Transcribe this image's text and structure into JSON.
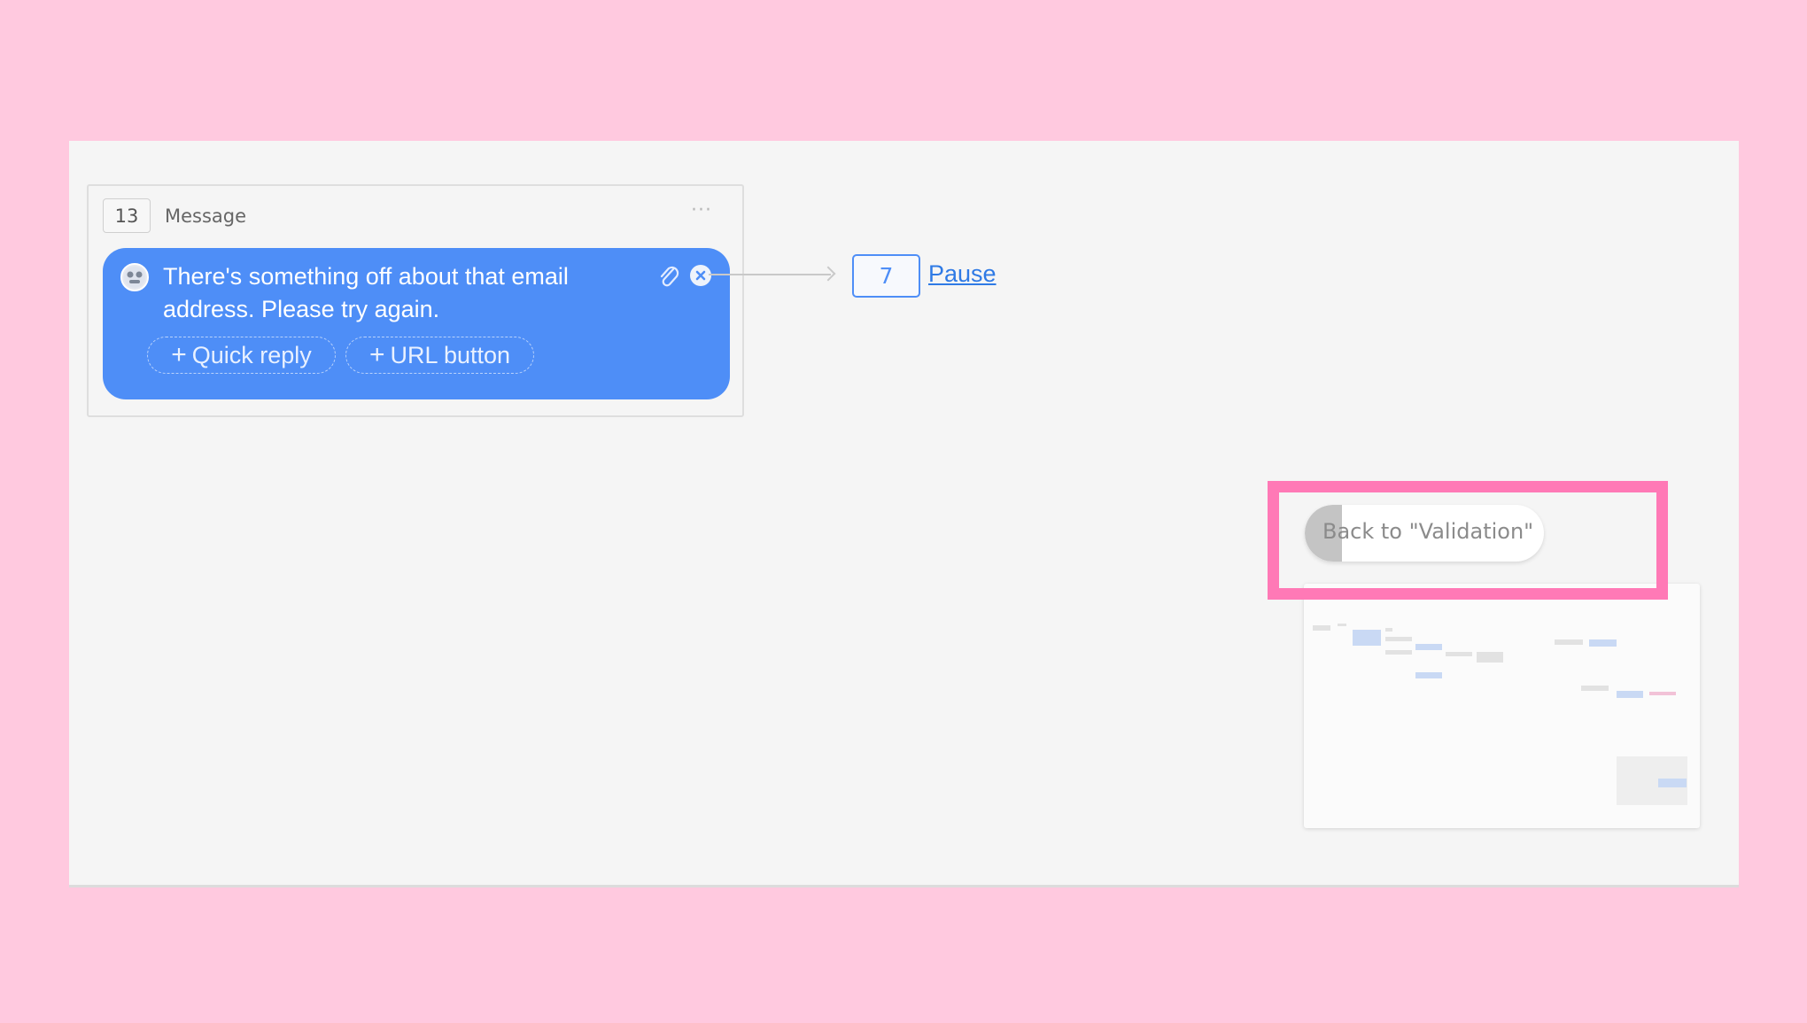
{
  "node": {
    "id": "13",
    "type": "Message",
    "menu_glyph": "···",
    "message": "There's something off about that email address. Please try again.",
    "quick_reply_label": "Quick reply",
    "url_button_label": "URL button",
    "plus_glyph": "+"
  },
  "link": {
    "target_id": "7",
    "target_label": "Pause"
  },
  "back_button": {
    "label": "Back to \"Validation\""
  },
  "colors": {
    "bubble": "#4e8ef7",
    "link": "#2f7ae5",
    "highlight": "#ff79b6",
    "outer_background": "#ffc9df",
    "canvas": "#f5f5f5"
  },
  "icons": [
    "bot-avatar-icon",
    "paperclip-icon",
    "close-circle-icon",
    "ellipsis-icon",
    "arrow-right-icon"
  ]
}
